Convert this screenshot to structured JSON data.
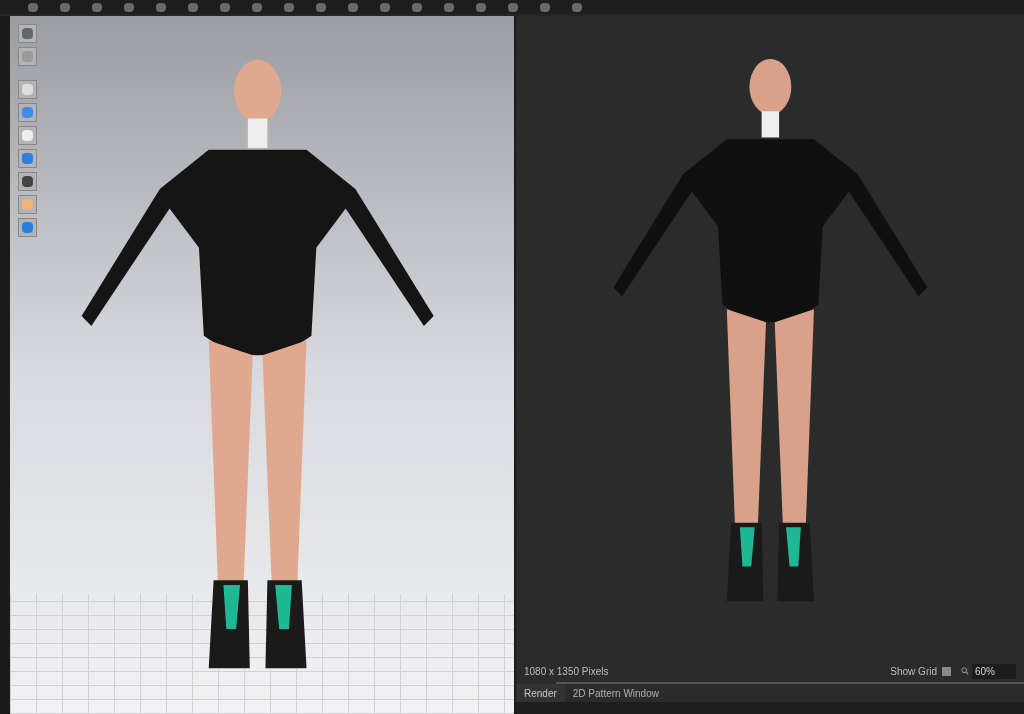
{
  "render_view": {
    "resolution": "1080 x 1350 Pixels",
    "show_grid": {
      "label": "Show Grid",
      "checked": false
    },
    "zoom": "60%"
  },
  "tabs": [
    {
      "label": "Render",
      "selected": true
    },
    {
      "label": "2D Pattern Window",
      "selected": false
    }
  ]
}
